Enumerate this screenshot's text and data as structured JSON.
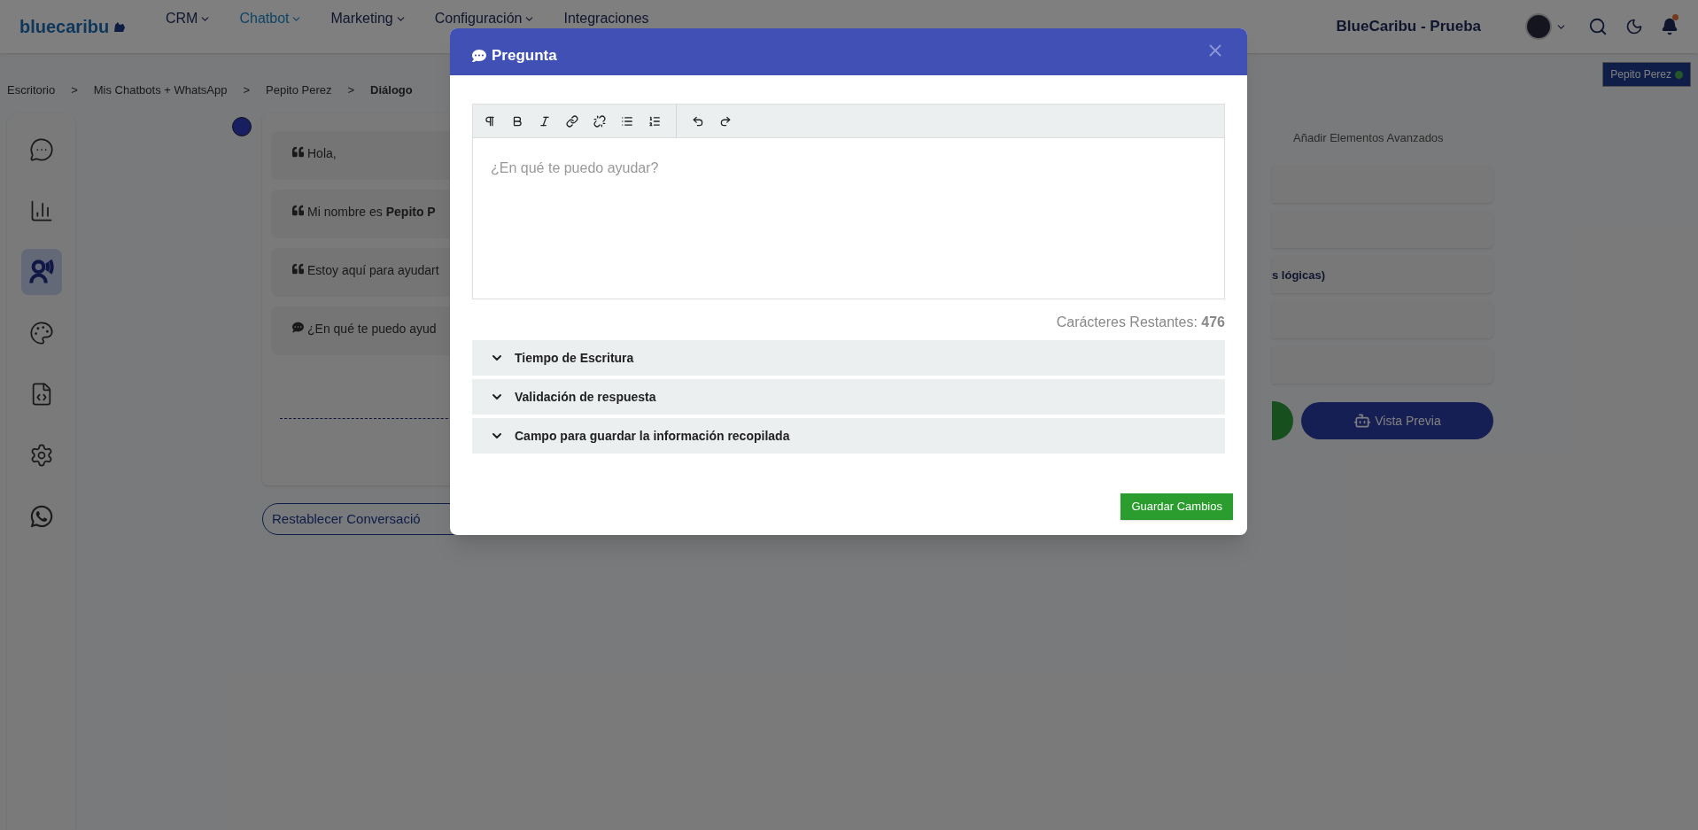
{
  "nav": {
    "logo": "bluecaribu",
    "menu": [
      {
        "label": "CRM",
        "selected": false,
        "dropdown": true
      },
      {
        "label": "Chatbot",
        "selected": true,
        "dropdown": true
      },
      {
        "label": "Marketing",
        "selected": false,
        "dropdown": true
      },
      {
        "label": "Configuración",
        "selected": false,
        "dropdown": true
      },
      {
        "label": "Integraciones",
        "selected": false,
        "dropdown": false
      }
    ],
    "account": "BlueCaribu - Prueba",
    "notification_dot": true
  },
  "breadcrumb": {
    "separator": ">",
    "items": [
      "Escritorio",
      "Mis Chatbots + WhatsApp",
      "Pepito Perez",
      "Diálogo"
    ]
  },
  "user_badge": {
    "name": "Pepito Perez",
    "online": true
  },
  "sidebar": {
    "items": [
      {
        "selected": false
      },
      {
        "selected": false
      },
      {
        "selected": true
      },
      {
        "selected": false
      },
      {
        "selected": false
      },
      {
        "selected": false
      },
      {
        "selected": false
      }
    ]
  },
  "conversation": {
    "messages": [
      {
        "kind": "quote",
        "text": "Hola,"
      },
      {
        "kind": "quote",
        "text": "Mi nombre es **Pepito P**"
      },
      {
        "kind": "quote",
        "text": "Estoy aquí para ayudart"
      },
      {
        "kind": "question",
        "text": "¿En qué te puedo ayud"
      }
    ],
    "reset_button": "Restablecer Conversació"
  },
  "right_panel": {
    "tab": "Añadir Elementos Avanzados",
    "rows": [
      {
        "kind": "blank"
      },
      {
        "kind": "blank"
      },
      {
        "kind": "text",
        "text": "s lógicas)"
      },
      {
        "kind": "blank"
      },
      {
        "kind": "blank"
      }
    ],
    "preview_button": "Vista Previa"
  },
  "modal": {
    "title": "Pregunta",
    "editor": {
      "placeholder": "¿En qué te puedo ayudar?"
    },
    "char_count": "Carácteres Restantes: **476**",
    "sections": [
      {
        "label": "Tiempo de Escritura",
        "expanded": false
      },
      {
        "label": "Validación de respuesta",
        "expanded": false
      },
      {
        "label": "Campo para guardar la información recopilada",
        "expanded": false
      }
    ],
    "save_button": "Guardar Cambios"
  }
}
